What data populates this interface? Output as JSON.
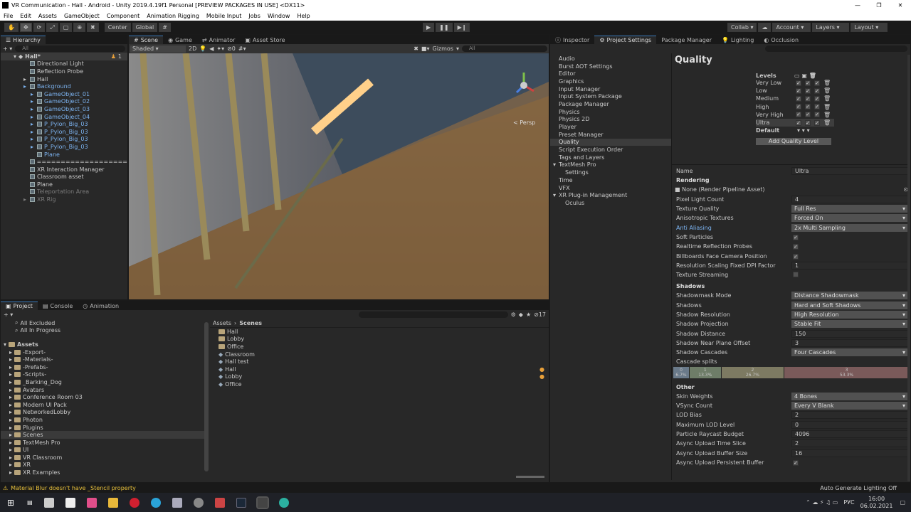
{
  "window": {
    "title": "VR Communication - Hall - Android - Unity 2019.4.19f1 Personal [PREVIEW PACKAGES IN USE] <DX11>"
  },
  "menu": [
    "File",
    "Edit",
    "Assets",
    "GameObject",
    "Component",
    "Animation Rigging",
    "Mobile Input",
    "Jobs",
    "Window",
    "Help"
  ],
  "toolbar": {
    "center": "Center",
    "global": "Global",
    "collab": "Collab ▾",
    "account": "Account",
    "layers": "Layers",
    "layout": "Layout"
  },
  "hierarchy": {
    "tab": "Hierarchy",
    "search": "All",
    "scene": "Hall*",
    "badge": "1",
    "items": [
      {
        "label": "Directional Light",
        "indent": 1,
        "style": ""
      },
      {
        "label": "Reflection Probe",
        "indent": 1,
        "style": ""
      },
      {
        "label": "Hall",
        "indent": 1,
        "style": ""
      },
      {
        "label": "Background",
        "indent": 1,
        "style": "blue"
      },
      {
        "label": "GameObject_01",
        "indent": 2,
        "style": "blue"
      },
      {
        "label": "GameObject_02",
        "indent": 2,
        "style": "blue"
      },
      {
        "label": "GameObject_03",
        "indent": 2,
        "style": "blue"
      },
      {
        "label": "GameObject_04",
        "indent": 2,
        "style": "blue"
      },
      {
        "label": "P_Pylon_Big_03",
        "indent": 2,
        "style": "blue"
      },
      {
        "label": "P_Pylon_Big_03",
        "indent": 2,
        "style": "blue"
      },
      {
        "label": "P_Pylon_Big_03",
        "indent": 2,
        "style": "blue"
      },
      {
        "label": "P_Pylon_Big_03",
        "indent": 2,
        "style": "blue"
      },
      {
        "label": "Plane",
        "indent": 2,
        "style": "blue"
      },
      {
        "label": "===================",
        "indent": 1,
        "style": ""
      },
      {
        "label": "XR Interaction Manager",
        "indent": 1,
        "style": ""
      },
      {
        "label": "Classroom asset",
        "indent": 1,
        "style": ""
      },
      {
        "label": "Plane",
        "indent": 1,
        "style": ""
      },
      {
        "label": "Teleportation Area",
        "indent": 1,
        "style": "grey"
      },
      {
        "label": "XR Rig",
        "indent": 1,
        "style": "grey"
      }
    ]
  },
  "scene": {
    "tabs": [
      "Scene",
      "Game",
      "Animator",
      "Asset Store"
    ],
    "shading": "Shaded",
    "mode2d": "2D",
    "gizmos": "Gizmos",
    "search": "All",
    "persp": "< Persp",
    "fx": "0"
  },
  "project": {
    "tabs": [
      "Project",
      "Console",
      "Animation"
    ],
    "count": "17",
    "favorites": [
      "All Excluded",
      "All In Progress"
    ],
    "assets_root": "Assets",
    "folders": [
      "-Export-",
      "-Materials-",
      "-Prefabs-",
      "-Scripts-",
      "_Barking_Dog",
      "Avatars",
      "Conference Room 03",
      "Modern UI Pack",
      "NetworkedLobby",
      "Photon",
      "Plugins",
      "Scenes",
      "TextMesh Pro",
      "UI",
      "VR Classroom",
      "XR",
      "XR Examples"
    ],
    "breadcrumb": [
      "Assets",
      "Scenes"
    ],
    "files": [
      "Hall",
      "Lobby",
      "Office",
      "Classroom",
      "Hall test",
      "Hall",
      "Lobby",
      "Office"
    ]
  },
  "settings": {
    "tabs": [
      "Inspector",
      "Project Settings",
      "Package Manager",
      "Lighting",
      "Occlusion"
    ],
    "categories": [
      "Audio",
      "Burst AOT Settings",
      "Editor",
      "Graphics",
      "Input Manager",
      "Input System Package",
      "Package Manager",
      "Physics",
      "Physics 2D",
      "Player",
      "Preset Manager",
      "Quality",
      "Script Execution Order",
      "Tags and Layers",
      "TextMesh Pro",
      "Settings",
      "Time",
      "VFX",
      "XR Plug-in Management",
      "Oculus"
    ],
    "title": "Quality",
    "levels_label": "Levels",
    "levels": [
      "Very Low",
      "Low",
      "Medium",
      "High",
      "Very High",
      "Ultra"
    ],
    "default_label": "Default",
    "add_level": "Add Quality Level",
    "name_label": "Name",
    "name_value": "Ultra",
    "rendering": "Rendering",
    "pipeline": "None (Render Pipeline Asset)",
    "rendering_props": [
      {
        "label": "Pixel Light Count",
        "value": "4",
        "type": "field"
      },
      {
        "label": "Texture Quality",
        "value": "Full Res",
        "type": "drop"
      },
      {
        "label": "Anisotropic Textures",
        "value": "Forced On",
        "type": "drop"
      },
      {
        "label": "Anti Aliasing",
        "value": "2x Multi Sampling",
        "type": "drop",
        "blue": true
      },
      {
        "label": "Soft Particles",
        "value": "✓",
        "type": "check"
      },
      {
        "label": "Realtime Reflection Probes",
        "value": "✓",
        "type": "check"
      },
      {
        "label": "Billboards Face Camera Position",
        "value": "✓",
        "type": "check"
      },
      {
        "label": "Resolution Scaling Fixed DPI Factor",
        "value": "1",
        "type": "field"
      },
      {
        "label": "Texture Streaming",
        "value": "",
        "type": "check"
      }
    ],
    "shadows": "Shadows",
    "shadow_props": [
      {
        "label": "Shadowmask Mode",
        "value": "Distance Shadowmask",
        "type": "drop"
      },
      {
        "label": "Shadows",
        "value": "Hard and Soft Shadows",
        "type": "drop"
      },
      {
        "label": "Shadow Resolution",
        "value": "High Resolution",
        "type": "drop"
      },
      {
        "label": "Shadow Projection",
        "value": "Stable Fit",
        "type": "drop"
      },
      {
        "label": "Shadow Distance",
        "value": "150",
        "type": "field"
      },
      {
        "label": "Shadow Near Plane Offset",
        "value": "3",
        "type": "field"
      },
      {
        "label": "Shadow Cascades",
        "value": "Four Cascades",
        "type": "drop"
      }
    ],
    "cascade_label": "Cascade splits",
    "cascades": [
      {
        "idx": "0",
        "pct": "6.7%",
        "frac": 0.067
      },
      {
        "idx": "1",
        "pct": "13.3%",
        "frac": 0.133
      },
      {
        "idx": "2",
        "pct": "26.7%",
        "frac": 0.267
      },
      {
        "idx": "3",
        "pct": "53.3%",
        "frac": 0.533
      }
    ],
    "other": "Other",
    "other_props": [
      {
        "label": "Skin Weights",
        "value": "4 Bones",
        "type": "drop"
      },
      {
        "label": "VSync Count",
        "value": "Every V Blank",
        "type": "drop"
      },
      {
        "label": "LOD Bias",
        "value": "2",
        "type": "field"
      },
      {
        "label": "Maximum LOD Level",
        "value": "0",
        "type": "field"
      },
      {
        "label": "Particle Raycast Budget",
        "value": "4096",
        "type": "field"
      },
      {
        "label": "Async Upload Time Slice",
        "value": "2",
        "type": "field"
      },
      {
        "label": "Async Upload Buffer Size",
        "value": "16",
        "type": "field"
      },
      {
        "label": "Async Upload Persistent Buffer",
        "value": "✓",
        "type": "check"
      }
    ]
  },
  "status": {
    "warning": "Material Blur doesn't have _Stencil property",
    "lighting": "Auto Generate Lighting Off"
  },
  "taskbar": {
    "lang": "РУС",
    "time": "16:00",
    "date": "06.02.2021"
  }
}
